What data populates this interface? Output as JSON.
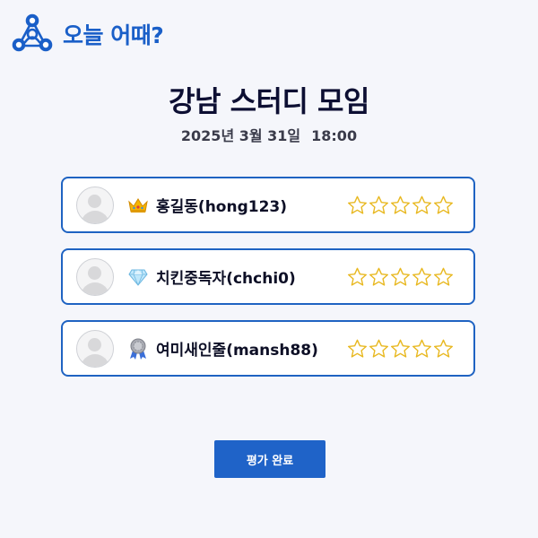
{
  "app": {
    "name": "오늘 어때?",
    "brand_color": "#1a5fc8"
  },
  "meeting": {
    "title": "강남 스터디 모임",
    "date": "2025년 3월 31일",
    "time": "18:00"
  },
  "participants": [
    {
      "name": "홍길동(hong123)",
      "badge_icon": "crown-icon",
      "rating": 0,
      "max_rating": 5
    },
    {
      "name": "치킨중독자(chchi0)",
      "badge_icon": "diamond-icon",
      "rating": 0,
      "max_rating": 5
    },
    {
      "name": "여미새인줄(mansh88)",
      "badge_icon": "medal-icon",
      "rating": 0,
      "max_rating": 5
    }
  ],
  "submit_button": {
    "label": "평가 완료"
  },
  "colors": {
    "card_border": "#1f63c2",
    "star_outline": "#e8b820",
    "button_bg": "#1f63c8"
  }
}
